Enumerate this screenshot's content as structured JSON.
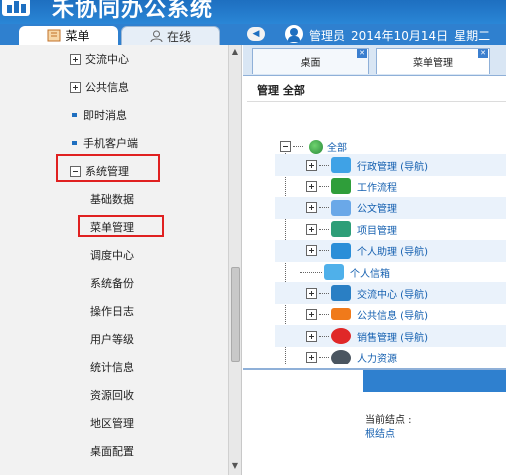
{
  "app": {
    "title": "禾协同办公系统"
  },
  "sidebar": {
    "tabs": [
      {
        "label": "菜单"
      },
      {
        "label": "在线"
      }
    ],
    "items": [
      {
        "label": "交流中心",
        "type": "collapsed"
      },
      {
        "label": "公共信息",
        "type": "collapsed"
      },
      {
        "label": "即时消息",
        "type": "bullet"
      },
      {
        "label": "手机客户端",
        "type": "bullet"
      },
      {
        "label": "系统管理",
        "type": "expanded"
      },
      {
        "label": "基础数据",
        "type": "child"
      },
      {
        "label": "菜单管理",
        "type": "child"
      },
      {
        "label": "调度中心",
        "type": "child"
      },
      {
        "label": "系统备份",
        "type": "child"
      },
      {
        "label": "操作日志",
        "type": "child"
      },
      {
        "label": "用户等级",
        "type": "child"
      },
      {
        "label": "统计信息",
        "type": "child"
      },
      {
        "label": "资源回收",
        "type": "child"
      },
      {
        "label": "地区管理",
        "type": "child"
      },
      {
        "label": "桌面配置",
        "type": "child"
      }
    ]
  },
  "infobar": {
    "collapse_glyph": "◀",
    "user": "管理员",
    "date": "2014年10月14日",
    "weekday": "星期二"
  },
  "main": {
    "tabs": [
      {
        "label": "桌面",
        "close": "✕"
      },
      {
        "label": "菜单管理",
        "close": "✕"
      }
    ],
    "title": "管理 全部",
    "tree": {
      "root": "全部",
      "nodes": [
        {
          "label": "行政管理 (导航)",
          "icon": "document-icon",
          "color": "#3fa2e6"
        },
        {
          "label": "工作流程",
          "icon": "workflow-icon",
          "color": "#2f9e3a"
        },
        {
          "label": "公文管理",
          "icon": "folder-icon",
          "color": "#6aa8e8"
        },
        {
          "label": "项目管理",
          "icon": "project-icon",
          "color": "#2e9e78"
        },
        {
          "label": "个人助理 (导航)",
          "icon": "assistant-icon",
          "color": "#2a8ed8"
        },
        {
          "label": "个人信箱",
          "icon": "mailbox-icon",
          "color": "#4fb0ea"
        },
        {
          "label": "交流中心 (导航)",
          "icon": "people-icon",
          "color": "#2a7fc4"
        },
        {
          "label": "公共信息 (导航)",
          "icon": "news-icon",
          "color": "#f07a1a"
        },
        {
          "label": "销售管理 (导航)",
          "icon": "dollar-icon",
          "color": "#e02828"
        },
        {
          "label": "人力资源",
          "icon": "hr-icon",
          "color": "#4a5560"
        }
      ]
    },
    "bottom": {
      "node_label": "当前结点 :",
      "node_value": "根结点"
    }
  },
  "colors": {
    "header": "#2a86d6",
    "highlight": "#e02020",
    "link": "#1560b0"
  }
}
